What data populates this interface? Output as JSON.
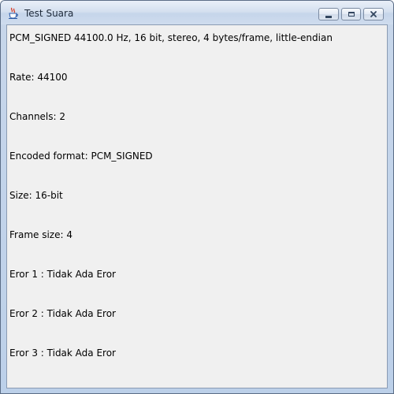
{
  "window": {
    "title": "Test Suara",
    "icon": "java-cup-icon",
    "controls": [
      "minimize-icon",
      "maximize-icon",
      "close-icon"
    ]
  },
  "content": {
    "format": "PCM_SIGNED 44100.0 Hz, 16 bit, stereo, 4 bytes/frame, little-endian",
    "rate": "Rate: 44100",
    "channels": "Channels: 2",
    "encoding": "Encoded format: PCM_SIGNED",
    "size": "Size: 16-bit",
    "frame_size": "Frame size: 4",
    "error1": "Eror 1 : Tidak Ada Eror",
    "error2": "Eror 2 : Tidak Ada Eror",
    "error3": "Eror 3 : Tidak Ada Eror"
  },
  "colors": {
    "content_background": "#f0f0f0",
    "text": "#000000",
    "titlebar": "#c7d6ea",
    "close_button": "#c75050"
  }
}
